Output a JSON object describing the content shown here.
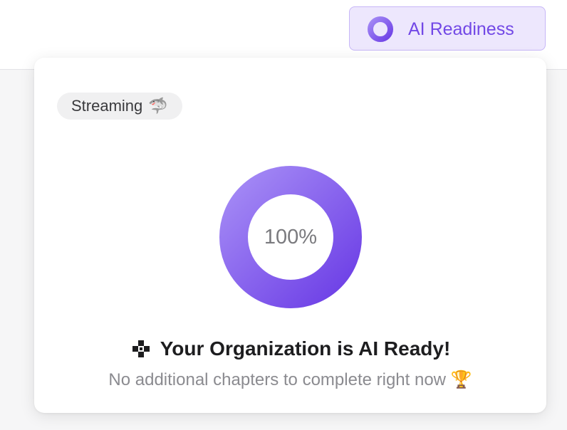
{
  "header": {
    "readiness_button": {
      "label": "AI Readiness",
      "icon": "ring-icon"
    }
  },
  "popover": {
    "badge": {
      "label": "Streaming",
      "emoji": "🦈"
    },
    "progress": {
      "value_text": "100%",
      "fraction": 1.0
    },
    "headline": {
      "icon": "sparkle-icon",
      "text": "Your Organization is AI Ready!"
    },
    "subline": {
      "text": "No additional chapters to complete right now",
      "emoji": "🏆"
    }
  },
  "colors": {
    "accent": "#7248e6",
    "accent_light": "#a48af5",
    "button_bg": "#ede7fd",
    "button_border": "#c7b6f7"
  }
}
